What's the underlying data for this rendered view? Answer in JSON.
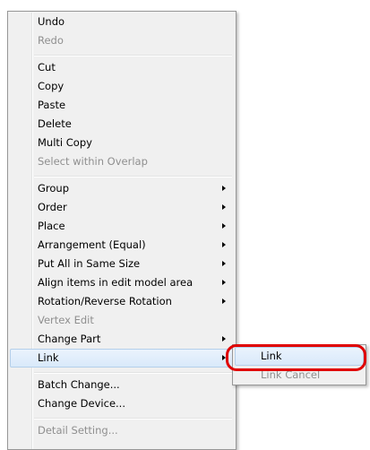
{
  "context_menu": {
    "items": [
      {
        "label": "Undo",
        "disabled": false
      },
      {
        "label": "Redo",
        "disabled": true
      },
      {
        "label": "Cut",
        "disabled": false
      },
      {
        "label": "Copy",
        "disabled": false
      },
      {
        "label": "Paste",
        "disabled": false
      },
      {
        "label": "Delete",
        "disabled": false
      },
      {
        "label": "Multi Copy",
        "disabled": false
      },
      {
        "label": "Select within Overlap",
        "disabled": true
      },
      {
        "label": "Group",
        "disabled": false,
        "submenu": true
      },
      {
        "label": "Order",
        "disabled": false,
        "submenu": true
      },
      {
        "label": "Place",
        "disabled": false,
        "submenu": true
      },
      {
        "label": "Arrangement (Equal)",
        "disabled": false,
        "submenu": true
      },
      {
        "label": "Put All in Same Size",
        "disabled": false,
        "submenu": true
      },
      {
        "label": "Align items in edit model area",
        "disabled": false,
        "submenu": true
      },
      {
        "label": "Rotation/Reverse Rotation",
        "disabled": false,
        "submenu": true
      },
      {
        "label": "Vertex Edit",
        "disabled": true
      },
      {
        "label": "Change Part",
        "disabled": false,
        "submenu": true
      },
      {
        "label": "Link",
        "disabled": false,
        "submenu": true,
        "highlighted": true
      },
      {
        "label": "Batch Change...",
        "disabled": false
      },
      {
        "label": "Change Device...",
        "disabled": false
      },
      {
        "label": "Detail Setting...",
        "disabled": true
      }
    ]
  },
  "link_submenu": {
    "items": [
      {
        "label": "Link",
        "disabled": false,
        "highlighted": true
      },
      {
        "label": "Link Cancel",
        "disabled": true
      }
    ]
  },
  "colors": {
    "menu_background": "#f0f0f0",
    "highlight": "#d9e9fa",
    "highlight_border": "#b4cfea",
    "disabled_text": "#8f8f8f",
    "annotation": "#e00000"
  }
}
